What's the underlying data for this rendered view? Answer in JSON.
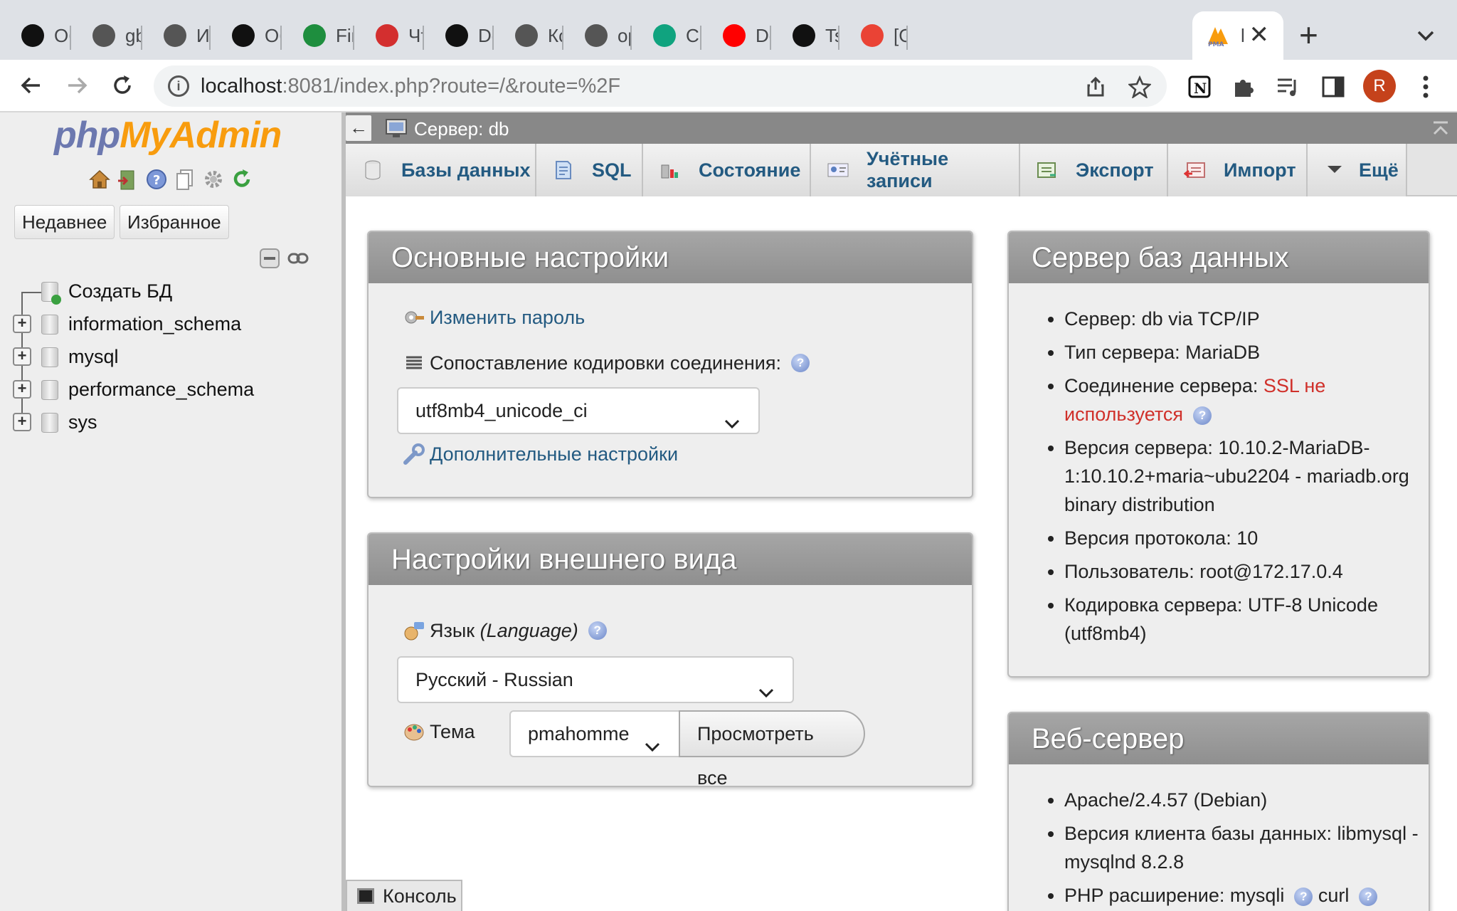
{
  "browser": {
    "tabs": [
      {
        "title": "Обу",
        "icon": "openai-icon",
        "color": "#111111"
      },
      {
        "title": "gbc",
        "icon": "globe-icon",
        "color": "#555555"
      },
      {
        "title": "Ито",
        "icon": "globe-icon",
        "color": "#555555"
      },
      {
        "title": "Обу",
        "icon": "openai-icon",
        "color": "#111111"
      },
      {
        "title": "Fina",
        "icon": "sheets-icon",
        "color": "#1e8e3e"
      },
      {
        "title": "Что",
        "icon": "rt-icon",
        "color": "#d32f2f"
      },
      {
        "title": "Doc",
        "icon": "openai-icon",
        "color": "#111111"
      },
      {
        "title": "Кон",
        "icon": "globe-icon",
        "color": "#555555"
      },
      {
        "title": "oper",
        "icon": "globe-icon",
        "color": "#555555"
      },
      {
        "title": "Cust",
        "icon": "chatgpt-icon",
        "color": "#10a37f"
      },
      {
        "title": "Doc",
        "icon": "youtube-icon",
        "color": "#ff0000"
      },
      {
        "title": "Tsoy",
        "icon": "github-icon",
        "color": "#111111"
      },
      {
        "title": "[Git",
        "icon": "gmail-icon",
        "color": "#ea4335"
      }
    ],
    "active_tab": {
      "title": "l",
      "icon": "pma-icon",
      "color": "#f89c0e"
    },
    "new_tab_label": "+",
    "url_host": "localhost",
    "url_rest": ":8081/index.php?route=/&route=%2F",
    "profile_initial": "R"
  },
  "nav": {
    "logo_php": "php",
    "logo_my": "MyAdmin",
    "recent_label": "Недавнее",
    "favorites_label": "Избранное",
    "create_db_label": "Создать БД",
    "databases": [
      "information_schema",
      "mysql",
      "performance_schema",
      "sys"
    ]
  },
  "server": {
    "title": "Сервер: db",
    "back_label": "←"
  },
  "menu": {
    "tabs": [
      "Базы данных",
      "SQL",
      "Состояние",
      "Учётные записи",
      "Экспорт",
      "Импорт",
      "Ещё"
    ]
  },
  "general": {
    "title": "Основные настройки",
    "change_password": "Изменить пароль",
    "collation_label": "Сопоставление кодировки соединения:",
    "collation_value": "utf8mb4_unicode_ci",
    "more_settings": "Дополнительные настройки"
  },
  "appearance": {
    "title": "Настройки внешнего вида",
    "language_label": "Язык",
    "language_label_en": "(Language)",
    "language_value": "Русский - Russian",
    "theme_label": "Тема",
    "theme_value": "pmahomme",
    "view_all": "Просмотреть все"
  },
  "db_server": {
    "title": "Сервер баз данных",
    "server": "Сервер: db via TCP/IP",
    "type": "Тип сервера: MariaDB",
    "conn_label": "Соединение сервера: ",
    "conn_ssl_1": "SSL не",
    "conn_ssl_2": "используется",
    "version_1": "Версия сервера: 10.10.2-MariaDB-",
    "version_2": "1:10.10.2+maria~ubu2204 - mariadb.org",
    "version_3": "binary distribution",
    "protocol": "Версия протокола: 10",
    "user": "Пользователь: root@172.17.0.4",
    "charset_1": "Кодировка сервера: UTF-8 Unicode",
    "charset_2": "(utf8mb4)"
  },
  "web_server": {
    "title": "Веб-сервер",
    "apache": "Apache/2.4.57 (Debian)",
    "client_1": "Версия клиента базы данных: libmysql -",
    "client_2": "mysqlnd 8.2.8",
    "php_ext": "PHP расширение: mysqli",
    "php_ext_2": "curl"
  },
  "console": {
    "label": "Консоль"
  },
  "colors": {
    "link": "#235a81",
    "panel_head": "#999999",
    "warning": "#d0302a",
    "logo_php": "#6c78af",
    "logo_my": "#f89c0e"
  }
}
